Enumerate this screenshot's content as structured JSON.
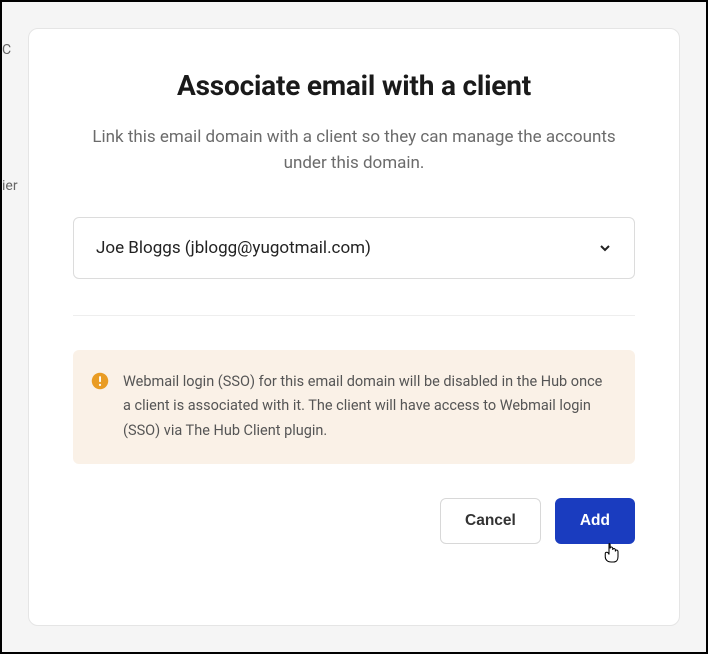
{
  "background": {
    "text1": "C",
    "text2": "ier"
  },
  "modal": {
    "title": "Associate email with a client",
    "description": "Link this email domain with a client so they can manage the accounts under this domain.",
    "select": {
      "selected": "Joe Bloggs (jblogg@yugotmail.com)"
    },
    "warning": {
      "message": "Webmail login (SSO) for this email domain will be disabled in the Hub once a client is associated with it. The client will have access to Webmail login (SSO) via The Hub Client plugin."
    },
    "buttons": {
      "cancel": "Cancel",
      "add": "Add"
    }
  }
}
